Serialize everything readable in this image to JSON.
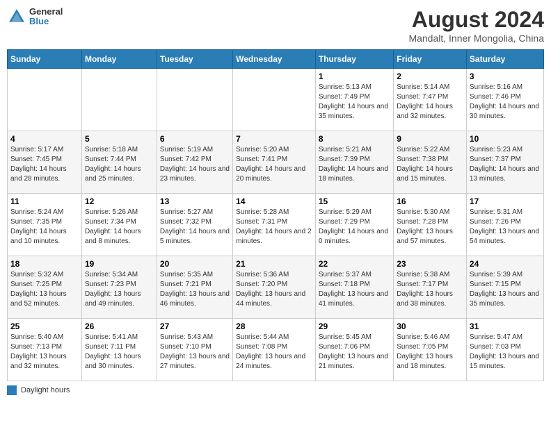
{
  "header": {
    "logo": {
      "line1": "General",
      "line2": "Blue"
    },
    "title": "August 2024",
    "subtitle": "Mandalt, Inner Mongolia, China"
  },
  "days_of_week": [
    "Sunday",
    "Monday",
    "Tuesday",
    "Wednesday",
    "Thursday",
    "Friday",
    "Saturday"
  ],
  "legend": {
    "label": "Daylight hours"
  },
  "weeks": [
    [
      {
        "day": null,
        "num": "",
        "sunrise": "",
        "sunset": "",
        "daylight": ""
      },
      {
        "day": null,
        "num": "",
        "sunrise": "",
        "sunset": "",
        "daylight": ""
      },
      {
        "day": null,
        "num": "",
        "sunrise": "",
        "sunset": "",
        "daylight": ""
      },
      {
        "day": null,
        "num": "",
        "sunrise": "",
        "sunset": "",
        "daylight": ""
      },
      {
        "day": 1,
        "num": "1",
        "sunrise": "Sunrise: 5:13 AM",
        "sunset": "Sunset: 7:49 PM",
        "daylight": "Daylight: 14 hours and 35 minutes."
      },
      {
        "day": 2,
        "num": "2",
        "sunrise": "Sunrise: 5:14 AM",
        "sunset": "Sunset: 7:47 PM",
        "daylight": "Daylight: 14 hours and 32 minutes."
      },
      {
        "day": 3,
        "num": "3",
        "sunrise": "Sunrise: 5:16 AM",
        "sunset": "Sunset: 7:46 PM",
        "daylight": "Daylight: 14 hours and 30 minutes."
      }
    ],
    [
      {
        "day": 4,
        "num": "4",
        "sunrise": "Sunrise: 5:17 AM",
        "sunset": "Sunset: 7:45 PM",
        "daylight": "Daylight: 14 hours and 28 minutes."
      },
      {
        "day": 5,
        "num": "5",
        "sunrise": "Sunrise: 5:18 AM",
        "sunset": "Sunset: 7:44 PM",
        "daylight": "Daylight: 14 hours and 25 minutes."
      },
      {
        "day": 6,
        "num": "6",
        "sunrise": "Sunrise: 5:19 AM",
        "sunset": "Sunset: 7:42 PM",
        "daylight": "Daylight: 14 hours and 23 minutes."
      },
      {
        "day": 7,
        "num": "7",
        "sunrise": "Sunrise: 5:20 AM",
        "sunset": "Sunset: 7:41 PM",
        "daylight": "Daylight: 14 hours and 20 minutes."
      },
      {
        "day": 8,
        "num": "8",
        "sunrise": "Sunrise: 5:21 AM",
        "sunset": "Sunset: 7:39 PM",
        "daylight": "Daylight: 14 hours and 18 minutes."
      },
      {
        "day": 9,
        "num": "9",
        "sunrise": "Sunrise: 5:22 AM",
        "sunset": "Sunset: 7:38 PM",
        "daylight": "Daylight: 14 hours and 15 minutes."
      },
      {
        "day": 10,
        "num": "10",
        "sunrise": "Sunrise: 5:23 AM",
        "sunset": "Sunset: 7:37 PM",
        "daylight": "Daylight: 14 hours and 13 minutes."
      }
    ],
    [
      {
        "day": 11,
        "num": "11",
        "sunrise": "Sunrise: 5:24 AM",
        "sunset": "Sunset: 7:35 PM",
        "daylight": "Daylight: 14 hours and 10 minutes."
      },
      {
        "day": 12,
        "num": "12",
        "sunrise": "Sunrise: 5:26 AM",
        "sunset": "Sunset: 7:34 PM",
        "daylight": "Daylight: 14 hours and 8 minutes."
      },
      {
        "day": 13,
        "num": "13",
        "sunrise": "Sunrise: 5:27 AM",
        "sunset": "Sunset: 7:32 PM",
        "daylight": "Daylight: 14 hours and 5 minutes."
      },
      {
        "day": 14,
        "num": "14",
        "sunrise": "Sunrise: 5:28 AM",
        "sunset": "Sunset: 7:31 PM",
        "daylight": "Daylight: 14 hours and 2 minutes."
      },
      {
        "day": 15,
        "num": "15",
        "sunrise": "Sunrise: 5:29 AM",
        "sunset": "Sunset: 7:29 PM",
        "daylight": "Daylight: 14 hours and 0 minutes."
      },
      {
        "day": 16,
        "num": "16",
        "sunrise": "Sunrise: 5:30 AM",
        "sunset": "Sunset: 7:28 PM",
        "daylight": "Daylight: 13 hours and 57 minutes."
      },
      {
        "day": 17,
        "num": "17",
        "sunrise": "Sunrise: 5:31 AM",
        "sunset": "Sunset: 7:26 PM",
        "daylight": "Daylight: 13 hours and 54 minutes."
      }
    ],
    [
      {
        "day": 18,
        "num": "18",
        "sunrise": "Sunrise: 5:32 AM",
        "sunset": "Sunset: 7:25 PM",
        "daylight": "Daylight: 13 hours and 52 minutes."
      },
      {
        "day": 19,
        "num": "19",
        "sunrise": "Sunrise: 5:34 AM",
        "sunset": "Sunset: 7:23 PM",
        "daylight": "Daylight: 13 hours and 49 minutes."
      },
      {
        "day": 20,
        "num": "20",
        "sunrise": "Sunrise: 5:35 AM",
        "sunset": "Sunset: 7:21 PM",
        "daylight": "Daylight: 13 hours and 46 minutes."
      },
      {
        "day": 21,
        "num": "21",
        "sunrise": "Sunrise: 5:36 AM",
        "sunset": "Sunset: 7:20 PM",
        "daylight": "Daylight: 13 hours and 44 minutes."
      },
      {
        "day": 22,
        "num": "22",
        "sunrise": "Sunrise: 5:37 AM",
        "sunset": "Sunset: 7:18 PM",
        "daylight": "Daylight: 13 hours and 41 minutes."
      },
      {
        "day": 23,
        "num": "23",
        "sunrise": "Sunrise: 5:38 AM",
        "sunset": "Sunset: 7:17 PM",
        "daylight": "Daylight: 13 hours and 38 minutes."
      },
      {
        "day": 24,
        "num": "24",
        "sunrise": "Sunrise: 5:39 AM",
        "sunset": "Sunset: 7:15 PM",
        "daylight": "Daylight: 13 hours and 35 minutes."
      }
    ],
    [
      {
        "day": 25,
        "num": "25",
        "sunrise": "Sunrise: 5:40 AM",
        "sunset": "Sunset: 7:13 PM",
        "daylight": "Daylight: 13 hours and 32 minutes."
      },
      {
        "day": 26,
        "num": "26",
        "sunrise": "Sunrise: 5:41 AM",
        "sunset": "Sunset: 7:11 PM",
        "daylight": "Daylight: 13 hours and 30 minutes."
      },
      {
        "day": 27,
        "num": "27",
        "sunrise": "Sunrise: 5:43 AM",
        "sunset": "Sunset: 7:10 PM",
        "daylight": "Daylight: 13 hours and 27 minutes."
      },
      {
        "day": 28,
        "num": "28",
        "sunrise": "Sunrise: 5:44 AM",
        "sunset": "Sunset: 7:08 PM",
        "daylight": "Daylight: 13 hours and 24 minutes."
      },
      {
        "day": 29,
        "num": "29",
        "sunrise": "Sunrise: 5:45 AM",
        "sunset": "Sunset: 7:06 PM",
        "daylight": "Daylight: 13 hours and 21 minutes."
      },
      {
        "day": 30,
        "num": "30",
        "sunrise": "Sunrise: 5:46 AM",
        "sunset": "Sunset: 7:05 PM",
        "daylight": "Daylight: 13 hours and 18 minutes."
      },
      {
        "day": 31,
        "num": "31",
        "sunrise": "Sunrise: 5:47 AM",
        "sunset": "Sunset: 7:03 PM",
        "daylight": "Daylight: 13 hours and 15 minutes."
      }
    ]
  ]
}
